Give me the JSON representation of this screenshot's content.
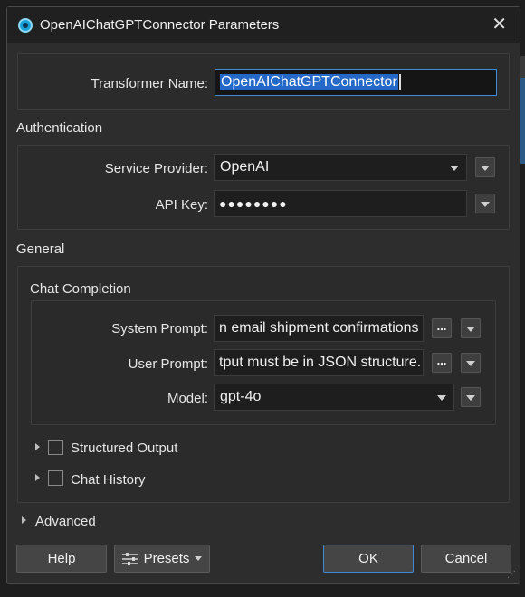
{
  "window": {
    "title": "OpenAIChatGPTConnector Parameters",
    "close_glyph": "✕"
  },
  "transformer": {
    "label": "Transformer Name:",
    "value": "OpenAIChatGPTConnector"
  },
  "authentication": {
    "title": "Authentication",
    "service_provider": {
      "label": "Service Provider:",
      "value": "OpenAI"
    },
    "api_key": {
      "label": "API Key:",
      "value": "●●●●●●●●"
    }
  },
  "general": {
    "title": "General",
    "chat_completion": {
      "title": "Chat Completion",
      "system_prompt": {
        "label": "System Prompt:",
        "value": "n email shipment confirmations"
      },
      "user_prompt": {
        "label": "User Prompt:",
        "value": "tput must be in JSON structure."
      },
      "model": {
        "label": "Model:",
        "value": "gpt-4o"
      }
    },
    "structured_output": {
      "label": "Structured Output",
      "checked": false
    },
    "chat_history": {
      "label": "Chat History",
      "checked": false
    }
  },
  "advanced": {
    "title": "Advanced"
  },
  "buttons": {
    "help": "Help",
    "help_underline": "H",
    "help_rest": "elp",
    "presets": "Presets",
    "presets_underline": "P",
    "presets_rest": "resets",
    "ok": "OK",
    "cancel": "Cancel",
    "ellipsis": "..."
  },
  "colors": {
    "accent": "#3f8ad8",
    "selection": "#2469c8",
    "dialog_bg": "#2d2d2d"
  }
}
